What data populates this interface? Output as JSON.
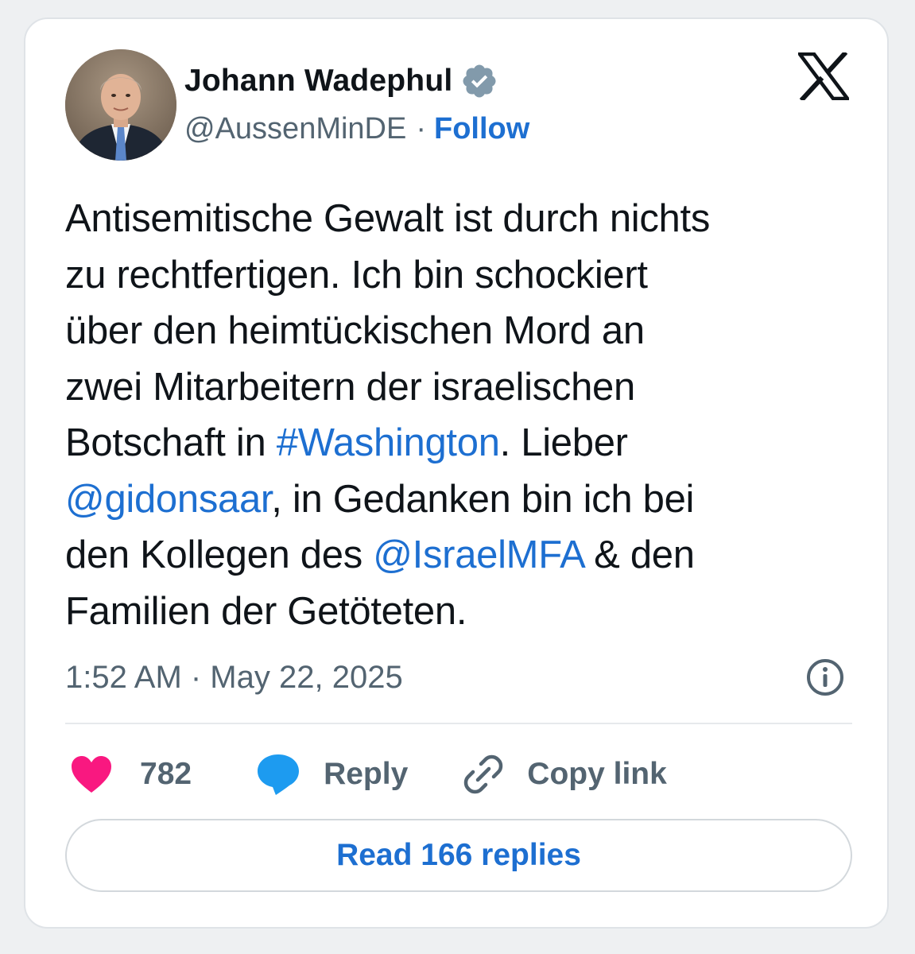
{
  "author": {
    "name": "Johann Wadephul",
    "handle": "@AussenMinDE",
    "separator": "·",
    "follow_label": "Follow"
  },
  "tweet": {
    "lines": [
      [
        {
          "t": "Antisemitische Gewalt ist durch nichts",
          "link": false
        }
      ],
      [
        {
          "t": "zu rechtfertigen. Ich bin schockiert",
          "link": false
        }
      ],
      [
        {
          "t": "über den heimtückischen Mord an",
          "link": false
        }
      ],
      [
        {
          "t": "zwei Mitarbeitern der israelischen",
          "link": false
        }
      ],
      [
        {
          "t": "Botschaft in ",
          "link": false
        },
        {
          "t": "#Washington",
          "link": true
        },
        {
          "t": ". Lieber",
          "link": false
        }
      ],
      [
        {
          "t": "@gidonsaar",
          "link": true
        },
        {
          "t": ", in Gedanken bin ich bei",
          "link": false
        }
      ],
      [
        {
          "t": "den Kollegen des ",
          "link": false
        },
        {
          "t": "@IsraelMFA",
          "link": true
        },
        {
          "t": " &  den",
          "link": false
        }
      ],
      [
        {
          "t": "Familien der Getöteten.",
          "link": false
        }
      ]
    ],
    "timestamp": "1:52 AM · May 22, 2025"
  },
  "actions": {
    "like_count": "782",
    "reply_label": "Reply",
    "copy_link_label": "Copy link"
  },
  "read_replies_label": "Read 166 replies",
  "icons": {
    "x_logo": "x-logo-icon",
    "verified": "verified-badge-icon",
    "info": "info-icon",
    "like": "heart-icon",
    "reply": "speech-bubble-icon",
    "copy": "link-chain-icon"
  },
  "colors": {
    "link": "#1d6fd1",
    "heart": "#f91880",
    "reply_bubble": "#1d9bf0",
    "secondary_text": "#536471",
    "primary_text": "#0f1419",
    "verified_badge": "#829aab"
  }
}
